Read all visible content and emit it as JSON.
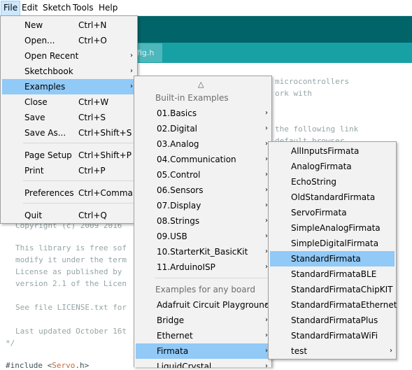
{
  "menubar": [
    "File",
    "Edit",
    "Sketch",
    "Tools",
    "Help"
  ],
  "tab_label": "fig.h",
  "code": {
    "line1": "microcontrollers",
    "line2": "ork with",
    "line3": "the following link",
    "line4": "default browser",
    "copyright": "Copyright (c) 2009 2016",
    "lib1": "This library is free sof",
    "lib2": "modify it under the term",
    "lib3": "License as published by",
    "lib4": "version 2.1 of the Licen",
    "see": "See file LICENSE.txt for",
    "updated": "Last updated October 16t",
    "close": "*/",
    "include_prefix": "#include <",
    "include_kw": "Servo",
    "include_suffix": ".h>"
  },
  "file_menu": [
    {
      "label": "New",
      "shortcut": "Ctrl+N"
    },
    {
      "label": "Open...",
      "shortcut": "Ctrl+O"
    },
    {
      "label": "Open Recent",
      "shortcut": "",
      "submenu": true
    },
    {
      "label": "Sketchbook",
      "shortcut": "",
      "submenu": true
    },
    {
      "label": "Examples",
      "shortcut": "",
      "submenu": true
    },
    {
      "label": "Close",
      "shortcut": "Ctrl+W"
    },
    {
      "label": "Save",
      "shortcut": "Ctrl+S"
    },
    {
      "label": "Save As...",
      "shortcut": "Ctrl+Shift+S"
    },
    {
      "label": "Page Setup",
      "shortcut": "Ctrl+Shift+P"
    },
    {
      "label": "Print",
      "shortcut": "Ctrl+P"
    },
    {
      "label": "Preferences",
      "shortcut": "Ctrl+Comma"
    },
    {
      "label": "Quit",
      "shortcut": "Ctrl+Q"
    }
  ],
  "examples_menu": {
    "scroll_up": "△",
    "header_builtin": "Built-in Examples",
    "builtin": [
      "01.Basics",
      "02.Digital",
      "03.Analog",
      "04.Communication",
      "05.Control",
      "06.Sensors",
      "07.Display",
      "08.Strings",
      "09.USB",
      "10.StarterKit_BasicKit",
      "11.ArduinoISP"
    ],
    "header_any": "Examples for any board",
    "any": [
      "Adafruit Circuit Playground",
      "Bridge",
      "Ethernet",
      "Firmata",
      "LiquidCrystal"
    ]
  },
  "firmata_menu": [
    "AllInputsFirmata",
    "AnalogFirmata",
    "EchoString",
    "OldStandardFirmata",
    "ServoFirmata",
    "SimpleAnalogFirmata",
    "SimpleDigitalFirmata",
    "StandardFirmata",
    "StandardFirmataBLE",
    "StandardFirmataChipKIT",
    "StandardFirmataEthernet",
    "StandardFirmataPlus",
    "StandardFirmataWiFi",
    "test"
  ],
  "arrow_glyph": "›",
  "colors": {
    "toolbar": "#006468",
    "tabstrip": "#17a1a5",
    "highlight": "#91c9f7"
  }
}
